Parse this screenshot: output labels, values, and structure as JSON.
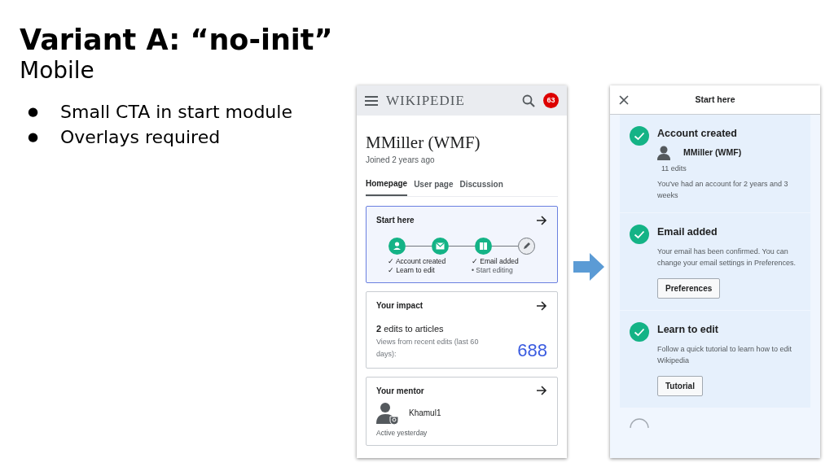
{
  "slide": {
    "title": "Variant A: “no-init”",
    "subtitle": "Mobile",
    "bullets": [
      {
        "marker": "●",
        "text": "Small CTA in start module"
      },
      {
        "marker": "●",
        "text": "Overlays required"
      }
    ]
  },
  "home_screen": {
    "wordmark": "WIKIPEDIE",
    "notification_count": "63",
    "user_name": "MMiller (WMF)",
    "joined": "Joined 2 years ago",
    "tabs": [
      {
        "label": "Homepage",
        "selected": true
      },
      {
        "label": "User page",
        "selected": false
      },
      {
        "label": "Discussion",
        "selected": false
      }
    ],
    "start_module": {
      "title": "Start here",
      "steps": [
        {
          "kind": "person",
          "done": true
        },
        {
          "kind": "envelope",
          "done": true
        },
        {
          "kind": "book",
          "done": true
        },
        {
          "kind": "pencil",
          "done": false
        }
      ],
      "checklist": [
        {
          "mark": "✓",
          "label": "Account created",
          "done": true
        },
        {
          "mark": "✓",
          "label": "Email added",
          "done": true
        },
        {
          "mark": "✓",
          "label": "Learn to edit",
          "done": true
        },
        {
          "mark": "•",
          "label": "Start editing",
          "done": false
        }
      ]
    },
    "impact": {
      "title": "Your impact",
      "edits_count": "2",
      "edits_label": "edits to articles",
      "views_label": "Views from recent edits (last 60 days):",
      "views": "688"
    },
    "mentor": {
      "title": "Your mentor",
      "name": "Khamul1",
      "activity": "Active yesterday"
    }
  },
  "overlay_screen": {
    "title": "Start here",
    "sections": [
      {
        "kind": "account",
        "done": true,
        "title": "Account created",
        "user_name": "MMiller (WMF)",
        "edits": "11 edits",
        "text": "You've had an account for 2 years and 3 weeks"
      },
      {
        "kind": "action",
        "done": true,
        "title": "Email added",
        "text": "Your email has been confirmed. You can change your email settings in Preferences.",
        "button": "Preferences"
      },
      {
        "kind": "action",
        "done": true,
        "title": "Learn to edit",
        "text": "Follow a quick tutorial to learn how to edit Wikipedia",
        "button": "Tutorial"
      },
      {
        "kind": "cut",
        "done": false
      }
    ]
  }
}
